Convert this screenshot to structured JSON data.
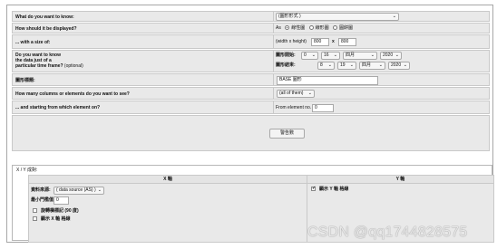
{
  "form": {
    "q_what": "What do you want to know:",
    "q_what_value": "(圖形形式 )",
    "q_display": "How should it be displayed?",
    "q_display_prefix": "As",
    "display_options": [
      "線性圖",
      "線形圖",
      "圓餅圖"
    ],
    "q_size": "... with a size of:",
    "size_prefix": "(width x height)",
    "size_width": "800",
    "size_x": "x",
    "size_height": "800",
    "q_date_line1": "Do you want to know",
    "q_date_line2": "the data just of a",
    "q_date_line3": "particular time frame?",
    "q_date_optional": "(optional)",
    "date_from_label": "圖形開始:",
    "date_from": {
      "hour": "0",
      "day": "16",
      "month": "四月",
      "year": "2020"
    },
    "date_to_label": "圖形結束:",
    "date_to": {
      "hour": "8",
      "day": "19",
      "month": "四月",
      "year": "2020"
    },
    "q_title": "圖形標題:",
    "title_value": "BASE 圖形",
    "q_columns": "How many columns or elements do you want to see?",
    "columns_value": "(all of them)",
    "q_start": "... and starting from which element on?",
    "start_prefix": "From element no.",
    "start_value": "0",
    "submit_label": "警告數"
  },
  "xy": {
    "section_title": "X / Y 成對:",
    "x_header": "X 軸",
    "y_header": "Y 軸",
    "data_source_label": "資料來源:",
    "data_source_value": "( data source (AS) )",
    "min_value_label": "最小門檻值:",
    "min_value": "0",
    "rotate_label": "旋轉橫標記 (90 度)",
    "show_x_label": "顯示 X 軸 格線",
    "show_y_label": "顯示 Y 軸 格線"
  },
  "watermark": "CSDN @qq1744828575"
}
